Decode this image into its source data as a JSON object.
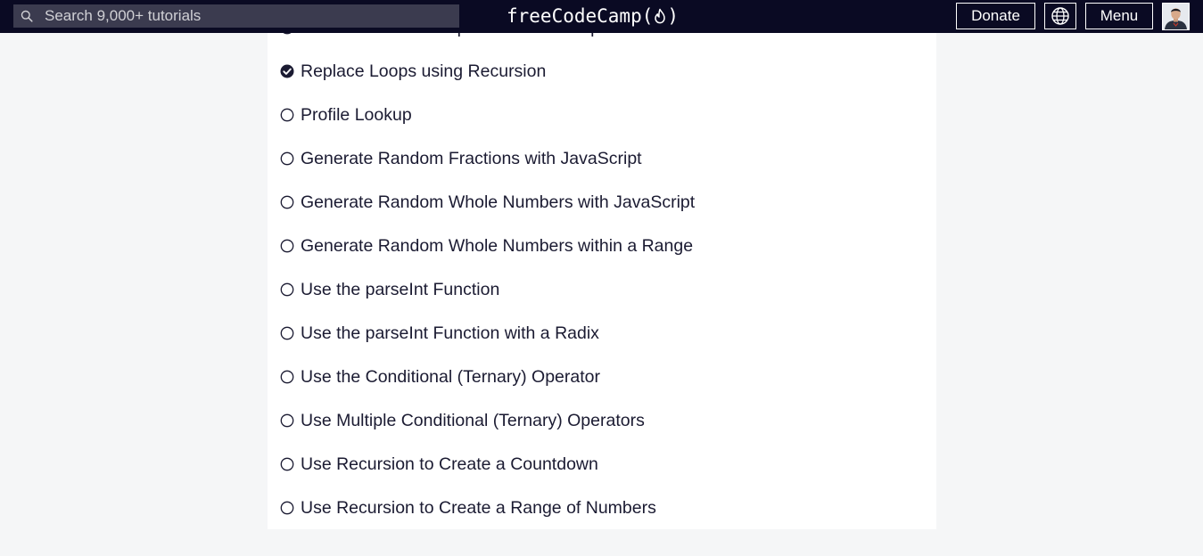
{
  "header": {
    "search_placeholder": "Search 9,000+ tutorials",
    "logo_text_left": "freeCodeCamp(",
    "logo_text_right": ")",
    "donate_label": "Donate",
    "menu_label": "Menu",
    "language_icon": "globe-icon",
    "avatar": "user-avatar"
  },
  "lessons": [
    {
      "title": "Iterate with JavaScript Do...While Loops",
      "status": "incomplete"
    },
    {
      "title": "Replace Loops using Recursion",
      "status": "completed"
    },
    {
      "title": "Profile Lookup",
      "status": "incomplete"
    },
    {
      "title": "Generate Random Fractions with JavaScript",
      "status": "incomplete"
    },
    {
      "title": "Generate Random Whole Numbers with JavaScript",
      "status": "incomplete"
    },
    {
      "title": "Generate Random Whole Numbers within a Range",
      "status": "incomplete"
    },
    {
      "title": "Use the parseInt Function",
      "status": "incomplete"
    },
    {
      "title": "Use the parseInt Function with a Radix",
      "status": "incomplete"
    },
    {
      "title": "Use the Conditional (Ternary) Operator",
      "status": "incomplete"
    },
    {
      "title": "Use Multiple Conditional (Ternary) Operators",
      "status": "incomplete"
    },
    {
      "title": "Use Recursion to Create a Countdown",
      "status": "incomplete"
    },
    {
      "title": "Use Recursion to Create a Range of Numbers",
      "status": "incomplete"
    }
  ],
  "colors": {
    "navbar": "#0a0a23",
    "search_bg": "#3b3b4f",
    "page_bg": "#f5f6f7",
    "text": "#1b1b32"
  }
}
